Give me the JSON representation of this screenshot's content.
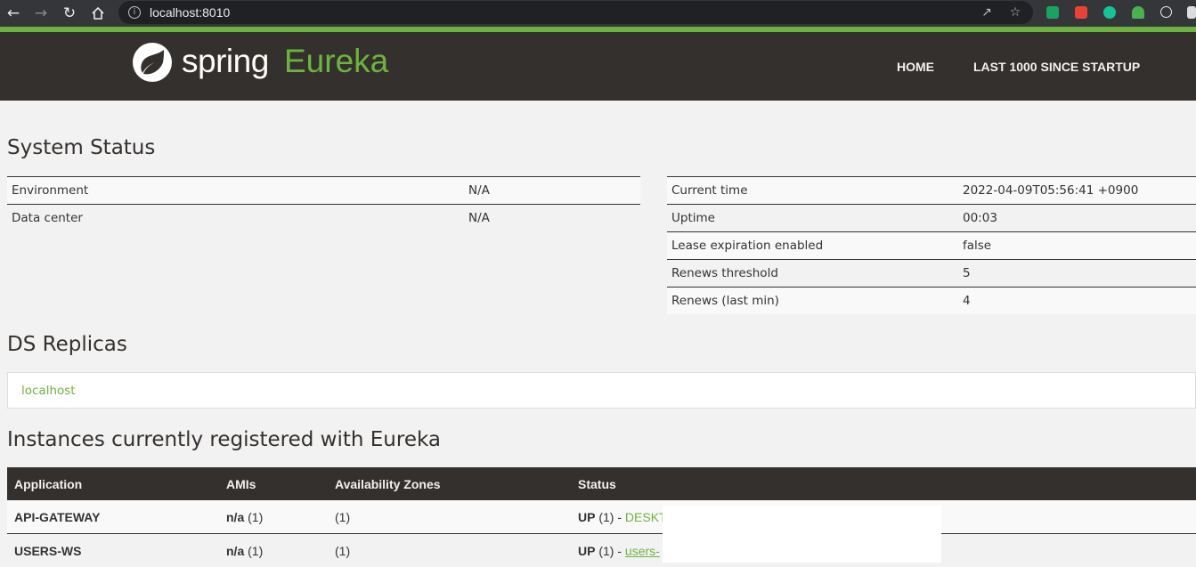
{
  "browser": {
    "url": "localhost:8010",
    "icons": [
      "back-arrow-icon",
      "forward-arrow-icon",
      "reload-icon",
      "home-icon",
      "site-info-icon",
      "share-icon",
      "bookmark-star-icon"
    ],
    "extension_colors": [
      "#1aa260",
      "#ea4335",
      "#15c39a",
      "#4caf50",
      "#61dafb",
      "#ffffff"
    ]
  },
  "header": {
    "brand_spring": "spring",
    "brand_eureka": "Eureka",
    "nav": {
      "home": "HOME",
      "last1000": "LAST 1000 SINCE STARTUP"
    },
    "accent_color": "#6db33f",
    "bg_color": "#34302d"
  },
  "system_status": {
    "title": "System Status",
    "left": [
      {
        "key": "Environment",
        "value": "N/A"
      },
      {
        "key": "Data center",
        "value": "N/A"
      }
    ],
    "right": [
      {
        "key": "Current time",
        "value": "2022-04-09T05:56:41 +0900"
      },
      {
        "key": "Uptime",
        "value": "00:03"
      },
      {
        "key": "Lease expiration enabled",
        "value": "false"
      },
      {
        "key": "Renews threshold",
        "value": "5"
      },
      {
        "key": "Renews (last min)",
        "value": "4"
      }
    ]
  },
  "ds_replicas": {
    "title": "DS Replicas",
    "items": [
      "localhost"
    ]
  },
  "instances": {
    "title": "Instances currently registered with Eureka",
    "columns": [
      "Application",
      "AMIs",
      "Availability Zones",
      "Status"
    ],
    "rows": [
      {
        "app": "API-GATEWAY",
        "ami": "n/a",
        "ami_count": "(1)",
        "zones": "(1)",
        "status": "UP",
        "status_count": "(1) -",
        "instance": "DESKT"
      },
      {
        "app": "USERS-WS",
        "ami": "n/a",
        "ami_count": "(1)",
        "zones": "(1)",
        "status": "UP",
        "status_count": "(1) -",
        "instance": "users-"
      }
    ]
  }
}
